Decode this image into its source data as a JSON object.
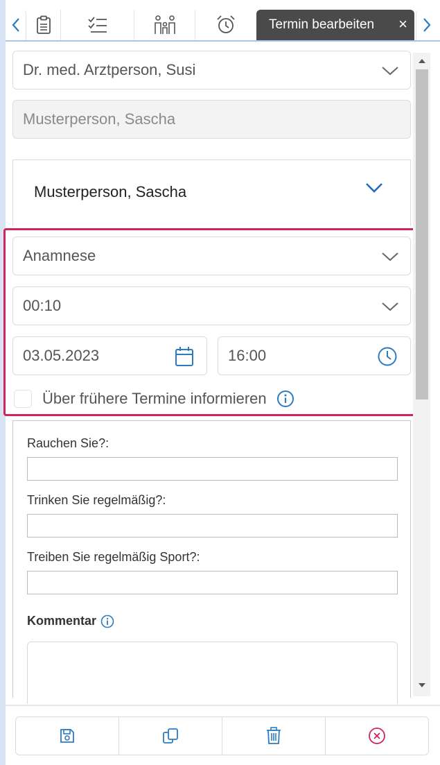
{
  "tabs": {
    "nav_left_icon": "chevron-left-icon",
    "nav_right_icon": "chevron-right-icon",
    "icon_tabs": [
      "clipboard-icon",
      "checklist-icon",
      "family-icon",
      "alarm-clock-icon"
    ],
    "active_label": "Termin bearbeiten",
    "close_label": "×"
  },
  "form": {
    "doctor": "Dr. med. Arztperson, Susi",
    "patient_readonly": "Musterperson, Sascha",
    "patient_card_name": "Musterperson, Sascha",
    "appointment_type": "Anamnese",
    "duration": "00:10",
    "date": "03.05.2023",
    "time": "16:00",
    "inform_checkbox_label": "Über frühere Termine informieren",
    "inform_checked": false
  },
  "questionnaire": {
    "q1_label": "Rauchen Sie?:",
    "q1_value": "",
    "q2_label": "Trinken Sie regelmäßig?:",
    "q2_value": "",
    "q3_label": "Treiben Sie regelmäßig Sport?:",
    "q3_value": "",
    "comment_label": "Kommentar",
    "comment_value": ""
  },
  "toolbar": {
    "buttons": [
      "save-icon",
      "copy-icon",
      "trash-icon",
      "cancel-circle-icon"
    ]
  },
  "colors": {
    "accent_blue": "#2a7bc4",
    "highlight_red": "#d0245a",
    "active_tab_bg": "#4a4a4a",
    "cancel_red": "#d0245a"
  }
}
